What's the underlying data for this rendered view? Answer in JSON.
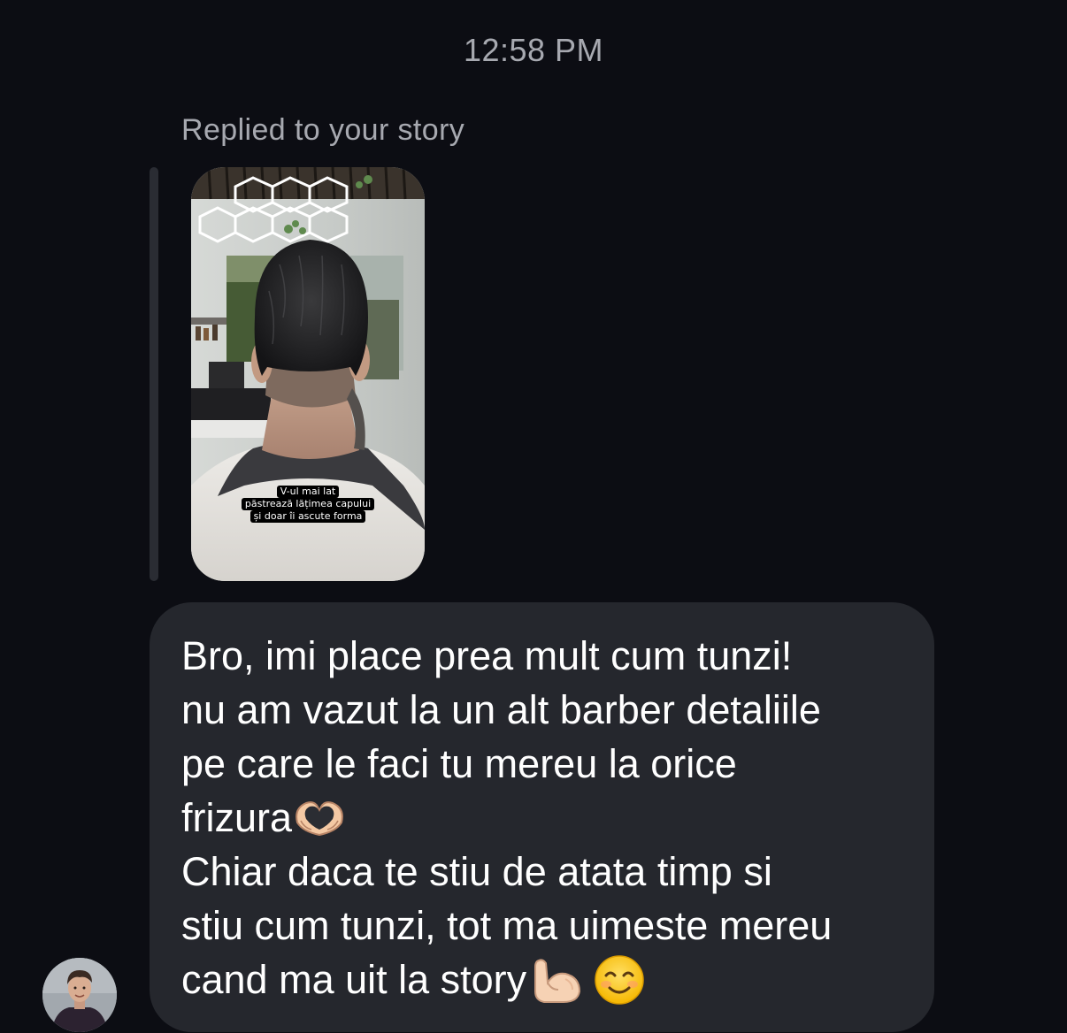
{
  "message": {
    "timestamp": "12:58 PM",
    "reply_label": "Replied to your story",
    "story": {
      "caption_lines": [
        "V-ul mai lat",
        "păstrează lățimea capului",
        "și doar îi ascute forma"
      ]
    },
    "bubble_lines": [
      "Bro, imi place prea mult cum tunzi!",
      "nu am vazut la un alt barber detaliile",
      "pe care le faci tu mereu la orice",
      "frizura",
      "Chiar daca te stiu de atata timp si",
      "stiu cum tunzi, tot ma uimeste mereu",
      "cand ma uit la story"
    ],
    "emojis": [
      "heart-hands-emoji",
      "flexed-biceps-emoji",
      "smiling-face-emoji"
    ]
  },
  "colors": {
    "background": "#0c0d13",
    "bubble": "#25272d",
    "muted_text": "#a7a9b0",
    "reply_bar": "#2a2c33"
  }
}
